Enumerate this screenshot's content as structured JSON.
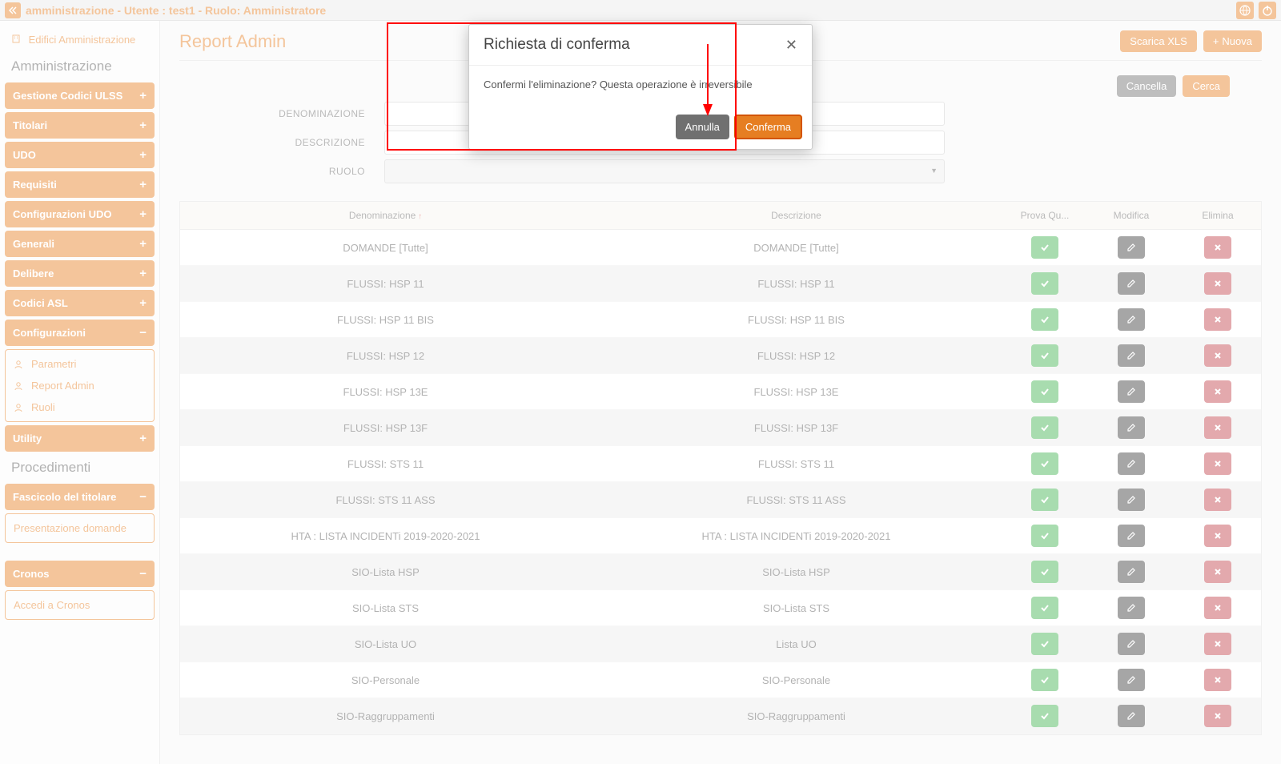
{
  "topbar": {
    "title": "amministrazione - Utente : test1 - Ruolo: Amministratore"
  },
  "breadcrumb": {
    "label": "Edifici Amministrazione"
  },
  "sidebar": {
    "section1": "Amministrazione",
    "items": [
      {
        "label": "Gestione Codici ULSS",
        "state": "collapsed"
      },
      {
        "label": "Titolari",
        "state": "collapsed"
      },
      {
        "label": "UDO",
        "state": "collapsed"
      },
      {
        "label": "Requisiti",
        "state": "collapsed"
      },
      {
        "label": "Configurazioni UDO",
        "state": "collapsed"
      },
      {
        "label": "Generali",
        "state": "collapsed"
      },
      {
        "label": "Delibere",
        "state": "collapsed"
      },
      {
        "label": "Codici ASL",
        "state": "collapsed"
      },
      {
        "label": "Configurazioni",
        "state": "expanded"
      }
    ],
    "config_sub": [
      {
        "label": "Parametri",
        "icon": "user"
      },
      {
        "label": "Report Admin",
        "icon": "user-plus"
      },
      {
        "label": "Ruoli",
        "icon": "user-plus"
      }
    ],
    "utility": {
      "label": "Utility",
      "state": "collapsed"
    },
    "section2": "Procedimenti",
    "fascicolo": {
      "label": "Fascicolo del titolare",
      "state": "expanded"
    },
    "fascicolo_sub": [
      {
        "label": "Presentazione domande"
      }
    ],
    "cronos": {
      "label": "Cronos",
      "state": "expanded"
    },
    "cronos_sub": [
      {
        "label": "Accedi a Cronos"
      }
    ]
  },
  "page": {
    "title": "Report Admin",
    "btn_xls": "Scarica XLS",
    "btn_new": "Nuova",
    "btn_cancel": "Cancella",
    "btn_search": "Cerca"
  },
  "filters": {
    "denom_label": "DENOMINAZIONE",
    "descr_label": "DESCRIZIONE",
    "ruolo_label": "RUOLO"
  },
  "table": {
    "headers": {
      "denom": "Denominazione",
      "descr": "Descrizione",
      "prova": "Prova Qu...",
      "mod": "Modifica",
      "elim": "Elimina"
    },
    "rows": [
      {
        "d": "DOMANDE [Tutte]",
        "s": "DOMANDE [Tutte]"
      },
      {
        "d": "FLUSSI: HSP 11",
        "s": "FLUSSI: HSP 11"
      },
      {
        "d": "FLUSSI: HSP 11 BIS",
        "s": "FLUSSI: HSP 11 BIS"
      },
      {
        "d": "FLUSSI: HSP 12",
        "s": "FLUSSI: HSP 12"
      },
      {
        "d": "FLUSSI: HSP 13E",
        "s": "FLUSSI: HSP 13E"
      },
      {
        "d": "FLUSSI: HSP 13F",
        "s": "FLUSSI: HSP 13F"
      },
      {
        "d": "FLUSSI: STS 11",
        "s": "FLUSSI: STS 11"
      },
      {
        "d": "FLUSSI: STS 11 ASS",
        "s": "FLUSSI: STS 11 ASS"
      },
      {
        "d": "HTA : LISTA INCIDENTi 2019-2020-2021",
        "s": "HTA : LISTA INCIDENTi 2019-2020-2021"
      },
      {
        "d": "SIO-Lista HSP",
        "s": "SIO-Lista HSP"
      },
      {
        "d": "SIO-Lista STS",
        "s": "SIO-Lista STS"
      },
      {
        "d": "SIO-Lista UO",
        "s": "Lista UO"
      },
      {
        "d": "SIO-Personale",
        "s": "SIO-Personale"
      },
      {
        "d": "SIO-Raggruppamenti",
        "s": "SIO-Raggruppamenti"
      }
    ]
  },
  "modal": {
    "title": "Richiesta di conferma",
    "body": "Confermi l'eliminazione? Questa operazione è irreversibile",
    "cancel": "Annulla",
    "confirm": "Conferma"
  }
}
